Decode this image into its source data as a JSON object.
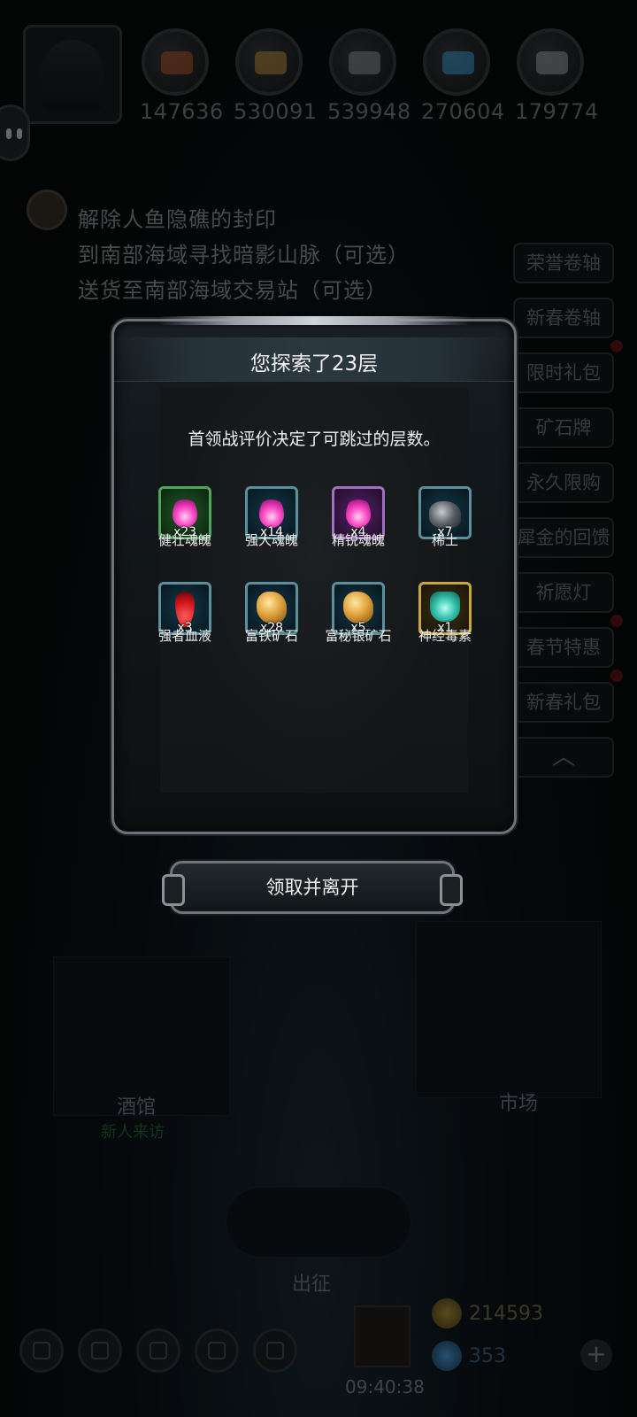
{
  "resources": [
    {
      "icon": "meat-icon",
      "value": "147636",
      "color": "#b5532a"
    },
    {
      "icon": "wood-icon",
      "value": "530091",
      "color": "#b98a3a"
    },
    {
      "icon": "stone-icon",
      "value": "539948",
      "color": "#8b8f93"
    },
    {
      "icon": "crystal-icon",
      "value": "270604",
      "color": "#3b9fd4"
    },
    {
      "icon": "iron-icon",
      "value": "179774",
      "color": "#9a9fa4"
    }
  ],
  "quests": [
    "解除人鱼隐礁的封印",
    "到南部海域寻找暗影山脉（可选）",
    "送货至南部海域交易站（可选）"
  ],
  "side_menu": [
    "荣誉卷轴",
    "新春卷轴",
    "限时礼包",
    "矿石牌",
    "永久限购",
    "犀金的回馈",
    "祈愿灯",
    "春节特惠",
    "新春礼包"
  ],
  "scene": {
    "tavern": "酒馆",
    "tavern_sub": "新人来访",
    "market": "市场",
    "expedition": "出征"
  },
  "currency": {
    "gold": "214593",
    "gems": "353",
    "time": "09:40:38"
  },
  "modal": {
    "title": "您探索了23层",
    "description": "首领战评价决定了可跳过的层数。",
    "items": [
      {
        "name": "健壮魂魄",
        "qty": "x23",
        "rarity": "green",
        "icon": "soul-orb-icon"
      },
      {
        "name": "强大魂魄",
        "qty": "x14",
        "rarity": "blue",
        "icon": "soul-orb-icon"
      },
      {
        "name": "精锐魂魄",
        "qty": "x4",
        "rarity": "purple",
        "icon": "soul-orb-icon"
      },
      {
        "name": "稀土",
        "qty": "x7",
        "rarity": "blue",
        "icon": "rare-earth-icon"
      },
      {
        "name": "强者血液",
        "qty": "x3",
        "rarity": "blue",
        "icon": "blood-drop-icon"
      },
      {
        "name": "富铁矿石",
        "qty": "x28",
        "rarity": "blue",
        "icon": "iron-ore-icon"
      },
      {
        "name": "富秘银矿石",
        "qty": "x5",
        "rarity": "blue",
        "icon": "mithril-ore-icon"
      },
      {
        "name": "神经毒素",
        "qty": "x1",
        "rarity": "gold",
        "icon": "neurotoxin-icon"
      }
    ],
    "claim_label": "领取并离开"
  }
}
